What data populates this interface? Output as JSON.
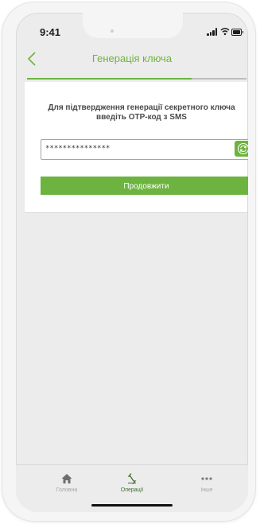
{
  "status_bar": {
    "time": "9:41",
    "icons": [
      "signal-icon",
      "wifi-icon",
      "battery-icon"
    ]
  },
  "header": {
    "title": "Генерація ключа",
    "back_icon": "chevron-left-icon"
  },
  "progress": {
    "fraction": 0.75
  },
  "form": {
    "instruction": "Для підтвердження генерації секретного ключа введіть ОТР-код з SMS",
    "otp_value": "***************",
    "refresh_icon": "refresh-icon",
    "continue_label": "Продовжити"
  },
  "tabbar": {
    "items": [
      {
        "label": "Головна",
        "icon": "home-icon",
        "active": false
      },
      {
        "label": "Операції",
        "icon": "transfer-icon",
        "active": true
      },
      {
        "label": "Інше",
        "icon": "more-icon",
        "active": false
      }
    ]
  },
  "colors": {
    "accent": "#6db33f",
    "background": "#ececec",
    "active_tab": "#3e6e2a",
    "inactive_tab": "#a6a6a6"
  }
}
